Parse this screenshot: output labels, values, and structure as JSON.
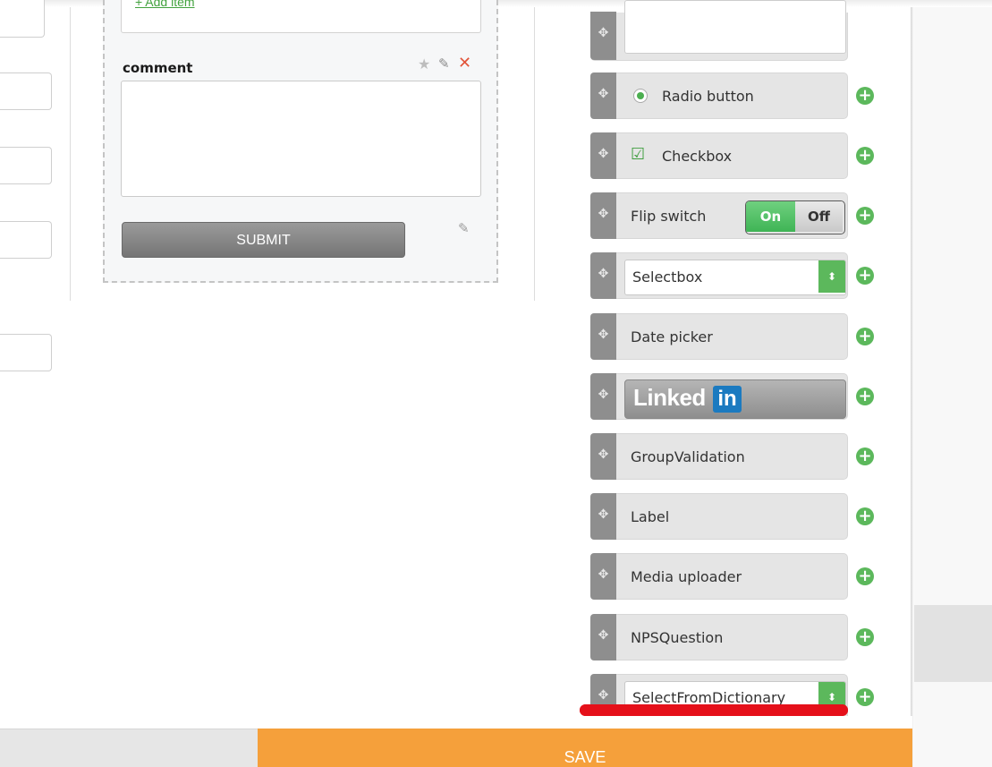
{
  "form": {
    "add_item": "+ Add item",
    "comment_label": "comment",
    "submit_label": "SUBMIT"
  },
  "palette": {
    "radio_label": "Radio button",
    "checkbox_label": "Checkbox",
    "flip_label": "Flip switch",
    "flip_on": "On",
    "flip_off": "Off",
    "selectbox_label": "Selectbox",
    "datepicker_label": "Date picker",
    "linkedin_text": "Linked",
    "linkedin_in": "in",
    "group_validation_label": "GroupValidation",
    "label_label": "Label",
    "media_uploader_label": "Media uploader",
    "nps_label": "NPSQuestion",
    "select_dictionary_label": "SelectFromDictionary"
  },
  "footer": {
    "save_label": "SAVE"
  },
  "colors": {
    "accent_green": "#5cb85c",
    "save_orange": "#f5a03b",
    "annotation_red": "#e5101a"
  },
  "icons": [
    "move-handle-icon",
    "add-icon",
    "star-icon",
    "pencil-icon",
    "delete-icon",
    "chevron-updown-icon",
    "check-icon"
  ]
}
